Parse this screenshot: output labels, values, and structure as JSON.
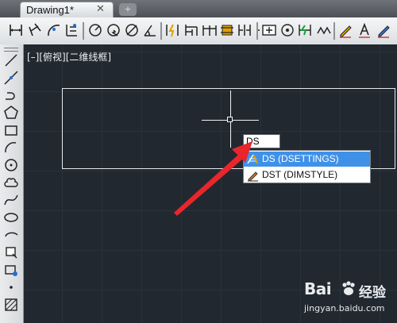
{
  "window": {
    "tab_title": "Drawing1*",
    "tab_close": "✕",
    "new_tab": "+"
  },
  "toolbar": {
    "icons": [
      "linear-dimension-icon",
      "aligned-dimension-icon",
      "arc-length-icon",
      "ordinate-dimension-icon",
      "radius-icon",
      "jogged-icon",
      "diameter-icon",
      "angular-icon",
      "quick-dimension-icon",
      "baseline-icon",
      "continue-icon",
      "dimension-space-icon",
      "dimension-break-icon",
      "tolerance-icon",
      "center-mark-icon",
      "inspection-icon",
      "jogged-linear-icon",
      "dimension-edit-icon",
      "dimension-text-edit-icon",
      "dimension-update-icon"
    ]
  },
  "left_toolbar": {
    "icons": [
      "line-icon",
      "construction-line-icon",
      "polyline-icon",
      "polygon-icon",
      "rectangle-icon",
      "arc-icon",
      "circle-icon",
      "revision-cloud-icon",
      "spline-icon",
      "ellipse-icon",
      "ellipse-arc-icon",
      "insert-block-icon",
      "make-block-icon",
      "point-icon",
      "hatch-icon"
    ]
  },
  "viewport": {
    "label": "[–][俯视][二维线框]"
  },
  "command": {
    "input_value": "DS",
    "suggestions": [
      {
        "label": "DS (DSETTINGS)",
        "icon": "drafting-settings-icon",
        "selected": true
      },
      {
        "label": "DST (DIMSTYLE)",
        "icon": "dimension-style-icon",
        "selected": false
      }
    ]
  },
  "watermark": {
    "logo_text": "Bai",
    "logo_cn": "经验",
    "url": "jingyan.baidu.com"
  },
  "colors": {
    "canvas_bg": "#212830",
    "selection": "#3f91e8",
    "annotation_arrow": "#e8262b"
  }
}
